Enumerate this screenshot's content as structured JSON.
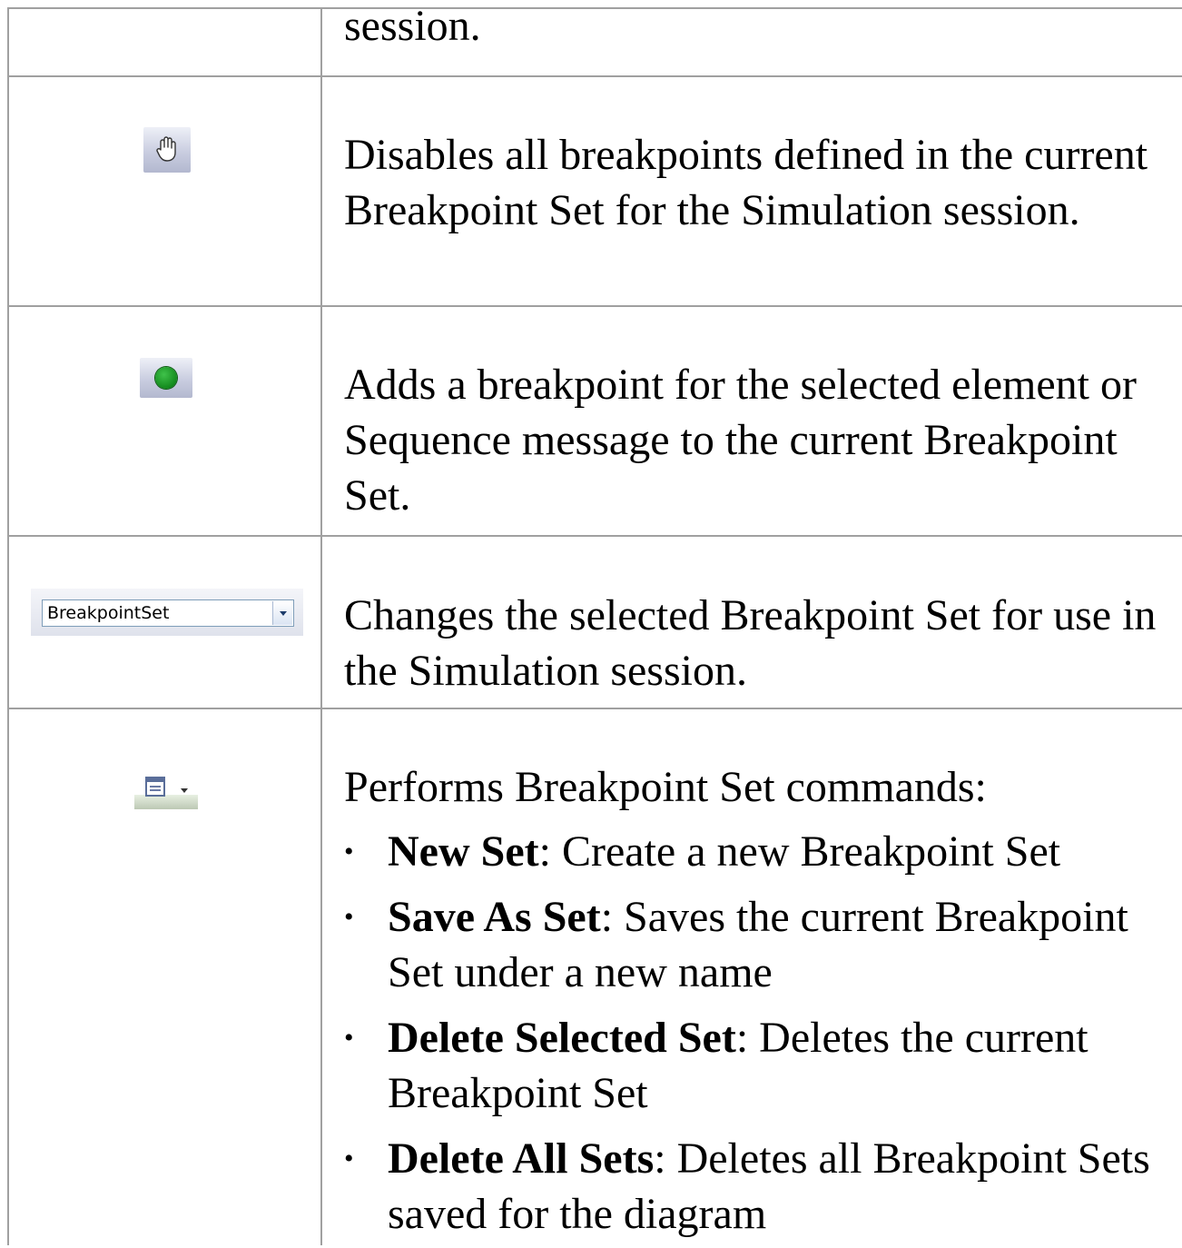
{
  "rows": [
    {
      "icon": "none",
      "text": "session."
    },
    {
      "icon": "hand-icon",
      "text": "Disables all breakpoints defined in the current Breakpoint Set for the Simulation session."
    },
    {
      "icon": "green-dot-icon",
      "text": "Adds a breakpoint for the selected element or Sequence message to the current Breakpoint Set."
    },
    {
      "icon": "combo-box",
      "combo_value": "BreakpointSet",
      "text": "Changes the selected Breakpoint Set for use in the Simulation session."
    },
    {
      "icon": "set-menu-icon",
      "text": "Performs Breakpoint Set commands:",
      "commands": [
        {
          "name": "New Set",
          "desc": ": Create a new Breakpoint Set"
        },
        {
          "name": "Save As Set",
          "desc": ": Saves the current Breakpoint Set under a new name"
        },
        {
          "name": "Delete Selected Set",
          "desc": ": Deletes the current Breakpoint Set"
        },
        {
          "name": "Delete All Sets",
          "desc": ": Deletes all Breakpoint Sets saved for the diagram"
        }
      ]
    }
  ],
  "colors": {
    "border": "#a0a0a0",
    "dot": "#138a1d",
    "combo_border": "#7f9db9"
  }
}
